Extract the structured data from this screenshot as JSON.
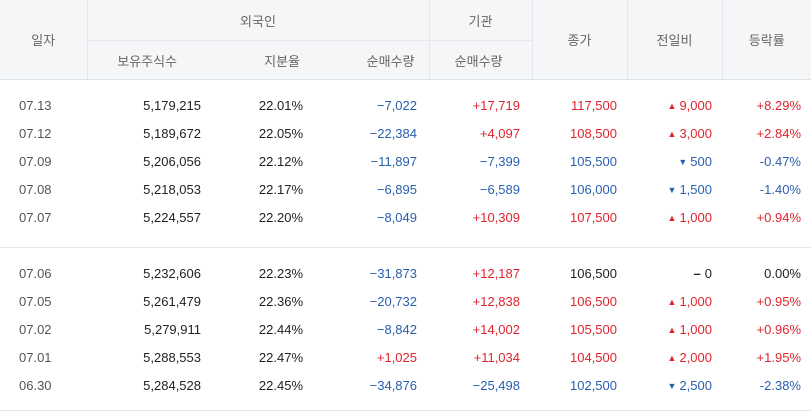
{
  "header": {
    "date": "일자",
    "foreign": "외국인",
    "institution": "기관",
    "close": "종가",
    "change": "전일비",
    "rate": "등락률",
    "holdings": "보유주식수",
    "ratio": "지분율",
    "foreign_net": "순매수량",
    "inst_net": "순매수량"
  },
  "groups": [
    [
      {
        "date": "07.13",
        "holdings": "5,179,215",
        "ratio": "22.01%",
        "foreign_net": "−7,022",
        "foreign_dir": "down",
        "inst_net": "+17,719",
        "inst_dir": "up",
        "close": "117,500",
        "close_dir": "up",
        "change": "9,000",
        "change_dir": "up",
        "rate": "+8.29%",
        "rate_dir": "up"
      },
      {
        "date": "07.12",
        "holdings": "5,189,672",
        "ratio": "22.05%",
        "foreign_net": "−22,384",
        "foreign_dir": "down",
        "inst_net": "+4,097",
        "inst_dir": "up",
        "close": "108,500",
        "close_dir": "up",
        "change": "3,000",
        "change_dir": "up",
        "rate": "+2.84%",
        "rate_dir": "up"
      },
      {
        "date": "07.09",
        "holdings": "5,206,056",
        "ratio": "22.12%",
        "foreign_net": "−11,897",
        "foreign_dir": "down",
        "inst_net": "−7,399",
        "inst_dir": "down",
        "close": "105,500",
        "close_dir": "down",
        "change": "500",
        "change_dir": "down",
        "rate": "-0.47%",
        "rate_dir": "down"
      },
      {
        "date": "07.08",
        "holdings": "5,218,053",
        "ratio": "22.17%",
        "foreign_net": "−6,895",
        "foreign_dir": "down",
        "inst_net": "−6,589",
        "inst_dir": "down",
        "close": "106,000",
        "close_dir": "down",
        "change": "1,500",
        "change_dir": "down",
        "rate": "-1.40%",
        "rate_dir": "down"
      },
      {
        "date": "07.07",
        "holdings": "5,224,557",
        "ratio": "22.20%",
        "foreign_net": "−8,049",
        "foreign_dir": "down",
        "inst_net": "+10,309",
        "inst_dir": "up",
        "close": "107,500",
        "close_dir": "up",
        "change": "1,000",
        "change_dir": "up",
        "rate": "+0.94%",
        "rate_dir": "up"
      }
    ],
    [
      {
        "date": "07.06",
        "holdings": "5,232,606",
        "ratio": "22.23%",
        "foreign_net": "−31,873",
        "foreign_dir": "down",
        "inst_net": "+12,187",
        "inst_dir": "up",
        "close": "106,500",
        "close_dir": "flat",
        "change": "0",
        "change_dir": "flat",
        "rate": "0.00%",
        "rate_dir": "flat"
      },
      {
        "date": "07.05",
        "holdings": "5,261,479",
        "ratio": "22.36%",
        "foreign_net": "−20,732",
        "foreign_dir": "down",
        "inst_net": "+12,838",
        "inst_dir": "up",
        "close": "106,500",
        "close_dir": "up",
        "change": "1,000",
        "change_dir": "up",
        "rate": "+0.95%",
        "rate_dir": "up"
      },
      {
        "date": "07.02",
        "holdings": "5,279,911",
        "ratio": "22.44%",
        "foreign_net": "−8,842",
        "foreign_dir": "down",
        "inst_net": "+14,002",
        "inst_dir": "up",
        "close": "105,500",
        "close_dir": "up",
        "change": "1,000",
        "change_dir": "up",
        "rate": "+0.96%",
        "rate_dir": "up"
      },
      {
        "date": "07.01",
        "holdings": "5,288,553",
        "ratio": "22.47%",
        "foreign_net": "+1,025",
        "foreign_dir": "up",
        "inst_net": "+11,034",
        "inst_dir": "up",
        "close": "104,500",
        "close_dir": "up",
        "change": "2,000",
        "change_dir": "up",
        "rate": "+1.95%",
        "rate_dir": "up"
      },
      {
        "date": "06.30",
        "holdings": "5,284,528",
        "ratio": "22.45%",
        "foreign_net": "−34,876",
        "foreign_dir": "down",
        "inst_net": "−25,498",
        "inst_dir": "down",
        "close": "102,500",
        "close_dir": "down",
        "change": "2,500",
        "change_dir": "down",
        "rate": "-2.38%",
        "rate_dir": "down"
      }
    ]
  ],
  "icons": {
    "up": "triangle-up-icon",
    "down": "triangle-down-icon",
    "flat": "dash-icon"
  },
  "colors": {
    "up": "#e0242d",
    "down": "#2a5fb0",
    "header_bg": "#f5f6f8"
  }
}
